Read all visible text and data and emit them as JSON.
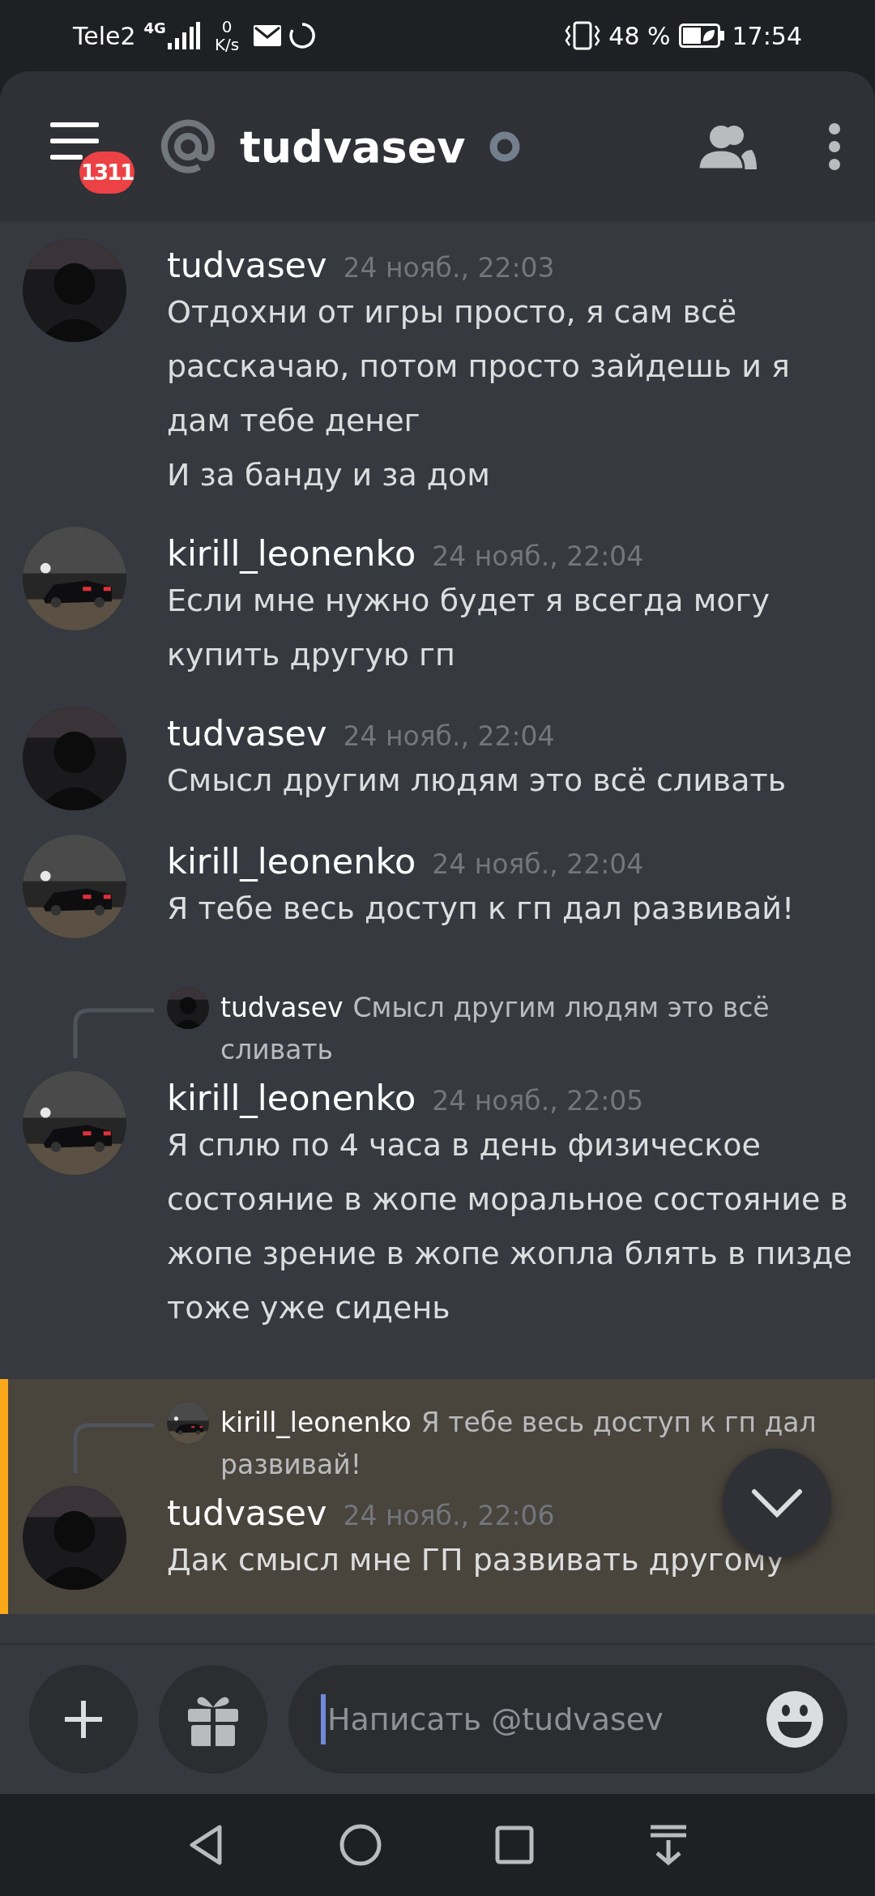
{
  "status_bar": {
    "carrier": "Tele2",
    "network": "4G",
    "speed_value": "0",
    "speed_unit": "K/s",
    "battery": "48 %",
    "time": "17:54"
  },
  "header": {
    "badge": "1311",
    "title": "tudvasev"
  },
  "messages": [
    {
      "author": "tudvasev",
      "timestamp": "24 нояб., 22:03",
      "mentioned": false,
      "text": [
        "Отдохни от игры просто, я сам всё расскачаю, потом просто зайдешь и я дам тебе денег",
        "И за банду и за дом"
      ]
    },
    {
      "author": "kirill_leonenko",
      "timestamp": "24 нояб., 22:04",
      "mentioned": false,
      "text": [
        "Если мне нужно будет я всегда могу купить другую гп"
      ]
    },
    {
      "author": "tudvasev",
      "timestamp": "24 нояб., 22:04",
      "mentioned": false,
      "text": [
        "Смысл другим людям это всё сливать"
      ]
    },
    {
      "author": "kirill_leonenko",
      "timestamp": "24 нояб., 22:04",
      "mentioned": false,
      "text": [
        "Я тебе весь доступ к гп дал развивай!"
      ]
    },
    {
      "author": "kirill_leonenko",
      "timestamp": "24 нояб., 22:05",
      "mentioned": false,
      "reply": {
        "author": "tudvasev",
        "text": "Смысл другим людям это всё сливать"
      },
      "text": [
        "Я сплю по 4 часа в день физическое состояние в жопе моральное состояние в жопе зрение в жопе жопла блять в пизде тоже уже сидень"
      ]
    },
    {
      "author": "tudvasev",
      "timestamp": "24 нояб., 22:06",
      "mentioned": true,
      "reply": {
        "author": "kirill_leonenko",
        "text": "Я тебе весь доступ к гп дал развивай!"
      },
      "text": [
        "Дак смысл мне ГП развивать другому"
      ]
    }
  ],
  "composer": {
    "placeholder": "Написать @tudvasev"
  }
}
